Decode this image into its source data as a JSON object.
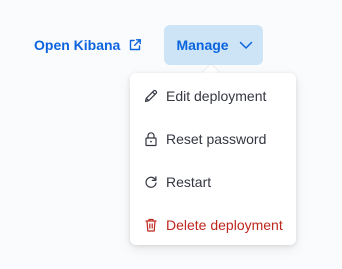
{
  "header": {
    "open_kibana_label": "Open Kibana",
    "manage_label": "Manage"
  },
  "menu": {
    "items": [
      {
        "label": "Edit deployment",
        "icon": "pencil-icon"
      },
      {
        "label": "Reset password",
        "icon": "lock-icon"
      },
      {
        "label": "Restart",
        "icon": "restart-icon"
      },
      {
        "label": "Delete deployment",
        "icon": "trash-icon"
      }
    ]
  },
  "colors": {
    "link": "#0b64dd",
    "button_bg": "#cce4f5",
    "text": "#343741",
    "danger": "#bd271e"
  }
}
